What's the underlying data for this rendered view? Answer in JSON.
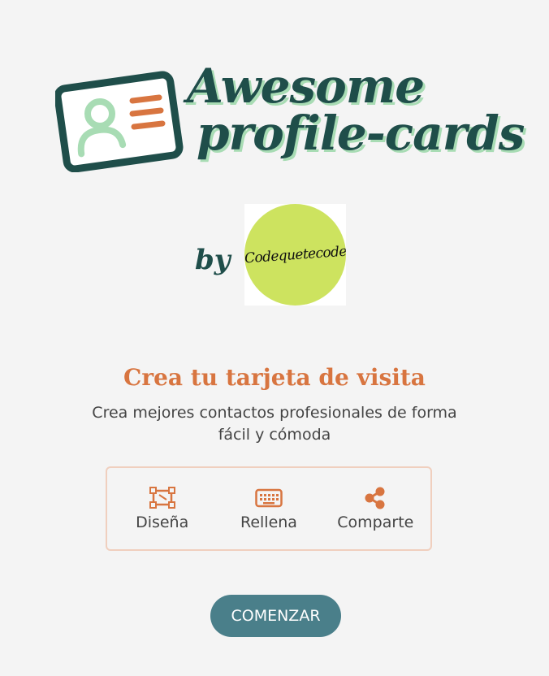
{
  "logo": {
    "line1": "Awesome",
    "line2": "profile-cards",
    "icon": "id-card-icon"
  },
  "by": {
    "label": "by",
    "author": "Codequetecode"
  },
  "hero": {
    "title": "Crea tu tarjeta de visita",
    "subtitle": "Crea mejores contactos profesionales de forma fácil y cómoda"
  },
  "steps": [
    {
      "label": "Diseña",
      "icon": "design-crop-icon"
    },
    {
      "label": "Rellena",
      "icon": "keyboard-icon"
    },
    {
      "label": "Comparte",
      "icon": "share-icon"
    }
  ],
  "cta": {
    "label": "COMENZAR"
  },
  "colors": {
    "background": "#f4f4f4",
    "brand_dark": "#1f4e4a",
    "brand_light": "#a8dcb4",
    "accent_orange": "#d87540",
    "button": "#4a7f8a",
    "author_badge": "#cde35f"
  }
}
